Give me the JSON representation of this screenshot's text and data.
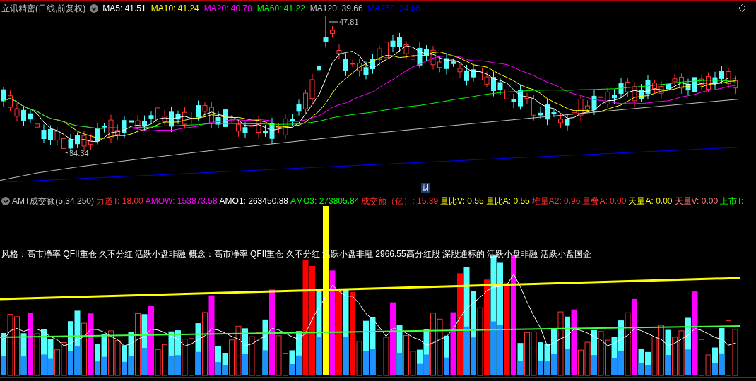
{
  "price_panel": {
    "title": "立讯精密(日线,前复权)",
    "indicators": [
      {
        "label": "MA5: 41.51",
        "color": "#ffffff"
      },
      {
        "label": "MA10: 41.24",
        "color": "#ffff00"
      },
      {
        "label": "MA20: 40.78",
        "color": "#ff00ff"
      },
      {
        "label": "MA60: 41.22",
        "color": "#00ff00"
      },
      {
        "label": "MA120: 39.66",
        "color": "#c0c0c0"
      },
      {
        "label": "MA250: 34.86",
        "color": "#0000ff"
      }
    ],
    "high_label": "47.81",
    "low_label": "34.34"
  },
  "event_marker": "财",
  "volume_panel": {
    "title": "AMT成交额(5,34,250)",
    "indicators": [
      {
        "label": "力道T: 18.00",
        "color": "#ff3232"
      },
      {
        "label": "AMOW: 153873.58",
        "color": "#ff00ff"
      },
      {
        "label": "AMO1: 263450.88",
        "color": "#ffffff"
      },
      {
        "label": "AMO3: 273805.84",
        "color": "#00ff00"
      },
      {
        "label": "成交额（亿）: 15.39",
        "color": "#ff3232"
      },
      {
        "label": "量比V: 0.55",
        "color": "#ffff00"
      },
      {
        "label": "量比A: 0.55",
        "color": "#ffff00"
      },
      {
        "label": "堆量A2: 0.96",
        "color": "#ff3232"
      },
      {
        "label": "量叠A: 0.00",
        "color": "#ff3232"
      },
      {
        "label": "天量A: 0.00",
        "color": "#ffff00"
      },
      {
        "label": "天量V: 0.00",
        "color": "#ff8080"
      },
      {
        "label": "上市T:",
        "color": "#00ff00"
      }
    ],
    "note": "风格：高市净率 QFII重仓 久不分红 活跃小盘非融 概念：高市净率 QFII重仓 久不分红 活跃小盘非融 2966.55高分红股 深股通标的 活跃小盘非融 活跃小盘国企"
  }
}
